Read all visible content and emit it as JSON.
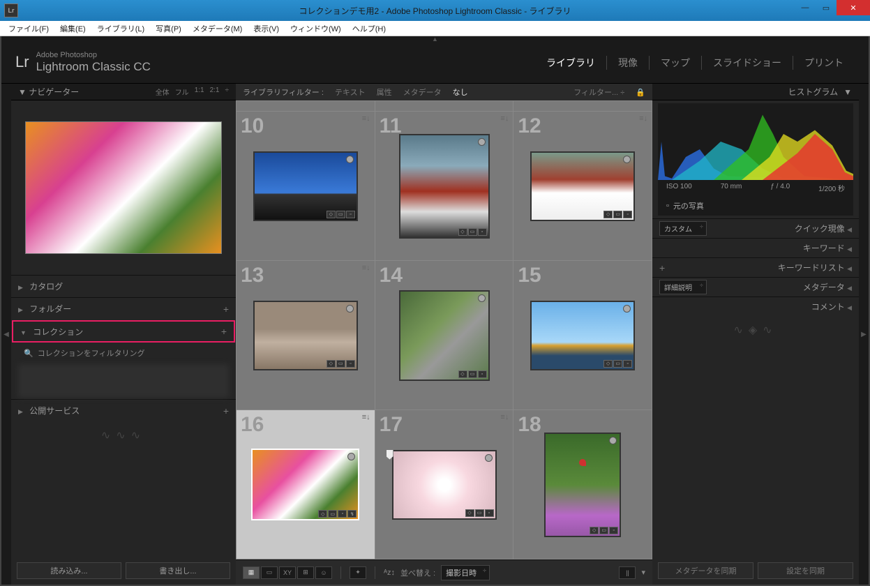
{
  "window": {
    "title": "コレクションデモ用2 - Adobe Photoshop Lightroom Classic - ライブラリ",
    "icon_text": "Lr"
  },
  "menubar": [
    "ファイル(F)",
    "編集(E)",
    "ライブラリ(L)",
    "写真(P)",
    "メタデータ(M)",
    "表示(V)",
    "ウィンドウ(W)",
    "ヘルプ(H)"
  ],
  "brand": {
    "small": "Adobe Photoshop",
    "main": "Lightroom Classic CC",
    "logo": "Lr"
  },
  "modules": [
    "ライブラリ",
    "現像",
    "マップ",
    "スライドショー",
    "プリント"
  ],
  "active_module": "ライブラリ",
  "left": {
    "navigator": {
      "title": "ナビゲーター",
      "opts": [
        "全体",
        "フル",
        "1:1",
        "2:1"
      ]
    },
    "sections": {
      "catalog": "カタログ",
      "folder": "フォルダー",
      "collection": "コレクション",
      "collection_filter": "コレクションをフィルタリング",
      "publish": "公開サービス"
    },
    "footer": {
      "import": "読み込み...",
      "export": "書き出し..."
    }
  },
  "filterbar": {
    "label": "ライブラリフィルター :",
    "options": [
      "テキスト",
      "属性",
      "メタデータ",
      "なし"
    ],
    "active": "なし",
    "dropdown": "フィルター..."
  },
  "cells": [
    {
      "n": "10"
    },
    {
      "n": "11"
    },
    {
      "n": "12"
    },
    {
      "n": "13"
    },
    {
      "n": "14"
    },
    {
      "n": "15"
    },
    {
      "n": "16"
    },
    {
      "n": "17"
    },
    {
      "n": "18"
    }
  ],
  "toolbar": {
    "sort_label": "並べ替え :",
    "sort_value": "撮影日時"
  },
  "right": {
    "histogram_title": "ヒストグラム",
    "meta": {
      "iso": "ISO 100",
      "focal": "70 mm",
      "aperture": "ƒ / 4.0",
      "shutter": "1/200 秒"
    },
    "original": "元の写真",
    "rows": {
      "custom": "カスタム",
      "quick": "クイック現像",
      "keyword": "キーワード",
      "keyword_list": "キーワードリスト",
      "detail": "詳細説明",
      "metadata": "メタデータ",
      "comment": "コメント"
    },
    "footer": {
      "sync_meta": "メタデータを同期",
      "sync_settings": "設定を同期"
    }
  }
}
